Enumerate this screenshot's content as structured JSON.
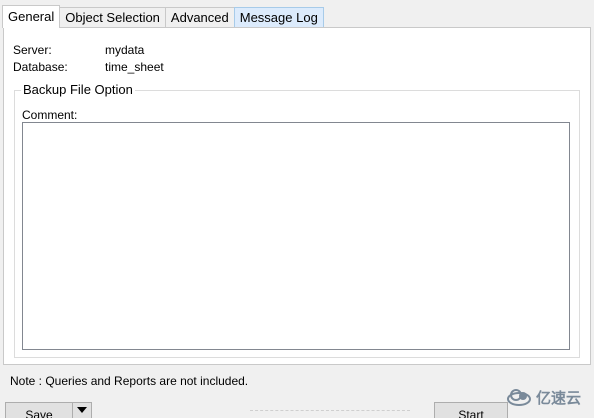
{
  "tabs": [
    {
      "label": "General",
      "active": true
    },
    {
      "label": "Object Selection",
      "active": false
    },
    {
      "label": "Advanced",
      "active": false
    },
    {
      "label": "Message Log",
      "active": false,
      "hover": true
    }
  ],
  "general": {
    "server_label": "Server:",
    "server_value": "mydata",
    "database_label": "Database:",
    "database_value": "time_sheet",
    "backup_group_title": "Backup File Option",
    "comment_label": "Comment:",
    "comment_value": ""
  },
  "note": "Note : Queries and Reports are not included.",
  "buttons": {
    "save_label": "Save",
    "start_label": "Start"
  },
  "watermark": {
    "text": "亿速云",
    "icon": "cloud-logo-icon"
  }
}
